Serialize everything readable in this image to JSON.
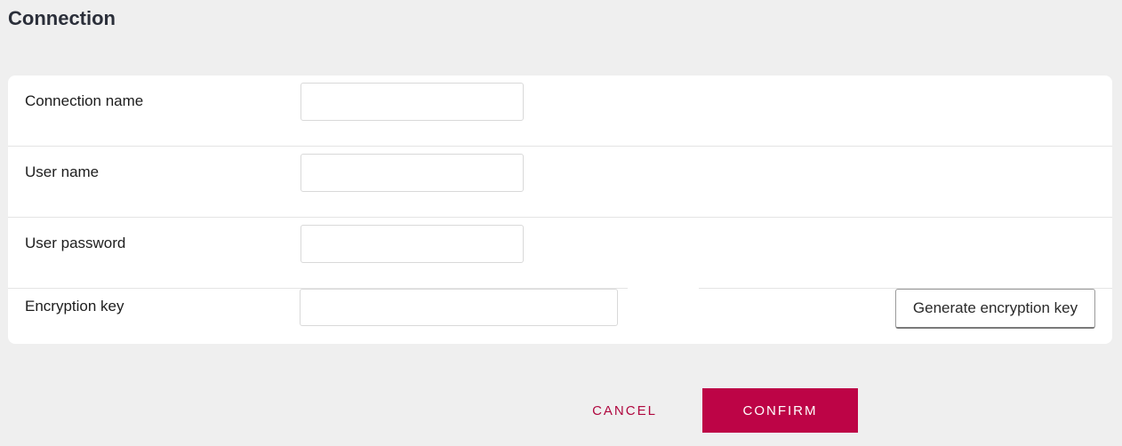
{
  "page": {
    "title": "Connection"
  },
  "form": {
    "fields": [
      {
        "label": "Connection name",
        "value": "",
        "placeholder": ""
      },
      {
        "label": "User name",
        "value": "",
        "placeholder": ""
      },
      {
        "label": "User password",
        "value": "",
        "placeholder": ""
      },
      {
        "label": "Encryption key",
        "value": "",
        "placeholder": ""
      }
    ],
    "generate_key_label": "Generate encryption key"
  },
  "actions": {
    "cancel_label": "CANCEL",
    "confirm_label": "CONFIRM"
  },
  "colors": {
    "background": "#efefef",
    "card": "#ffffff",
    "accent": "#bd0446",
    "title": "#2b2f3a"
  }
}
